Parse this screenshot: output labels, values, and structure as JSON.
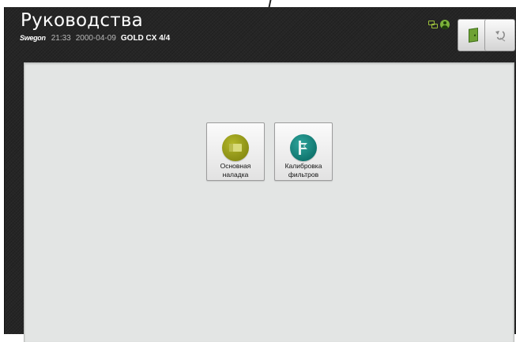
{
  "header": {
    "title": "Руководства",
    "brand": "Swegon",
    "time": "21:33",
    "date": "2000-04-09",
    "unit": "GOLD CX 4/4"
  },
  "status_icons": [
    "network-icon",
    "user-icon"
  ],
  "toolbar": {
    "exit_icon": "exit-door-icon",
    "back_icon": "back-arrow-icon"
  },
  "tiles": [
    {
      "label_line1": "Основная",
      "label_line2": "наладка",
      "icon": "basic-setup-icon",
      "color": "#9a9e1c"
    },
    {
      "label_line1": "Калибровка",
      "label_line2": "фильтров",
      "icon": "filter-calibration-icon",
      "color": "#17857d"
    }
  ],
  "colors": {
    "background": "#262626",
    "panel": "#e3e5e4",
    "accent_green": "#7cb33a"
  }
}
